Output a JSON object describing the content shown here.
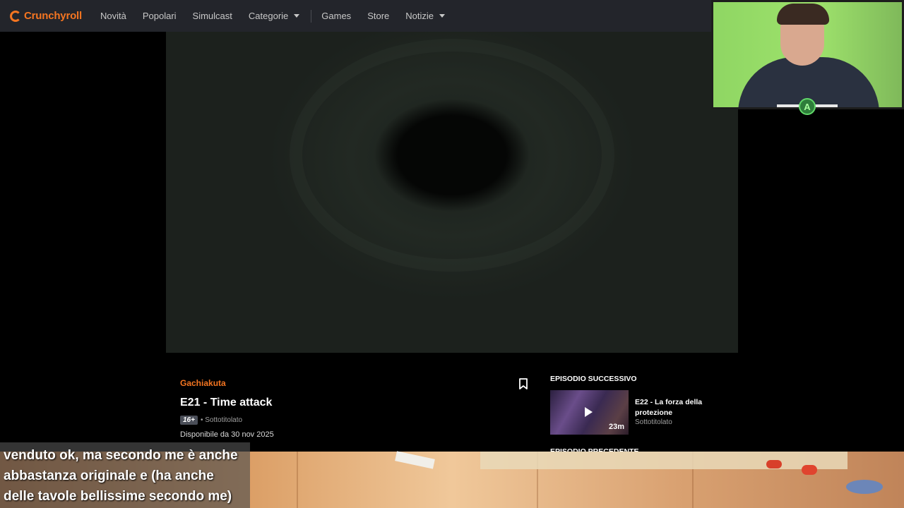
{
  "header": {
    "logo_text": "Crunchyroll",
    "nav": [
      "Novità",
      "Popolari",
      "Simulcast",
      "Categorie",
      "Games",
      "Store",
      "Notizie"
    ]
  },
  "episode": {
    "series": "Gachiakuta",
    "title": "E21 - Time attack",
    "rating": "16+",
    "subtitle_status": "• Sottotitolato",
    "available": "Disponibile da 30 nov 2025"
  },
  "next": {
    "label": "EPISODIO SUCCESSIVO",
    "title": "E22 - La forza della protezione",
    "subtitle_status": "Sottotitolato",
    "duration": "23m"
  },
  "previous": {
    "label": "EPISODIO PRECEDENTE"
  },
  "overlay": {
    "caption": "venduto ok, ma secondo me è anche abbastanza originale e (ha anche delle tavole bellissime secondo me)",
    "badge": "A"
  },
  "colors": {
    "accent": "#f47521",
    "header_bg": "#23252b"
  }
}
